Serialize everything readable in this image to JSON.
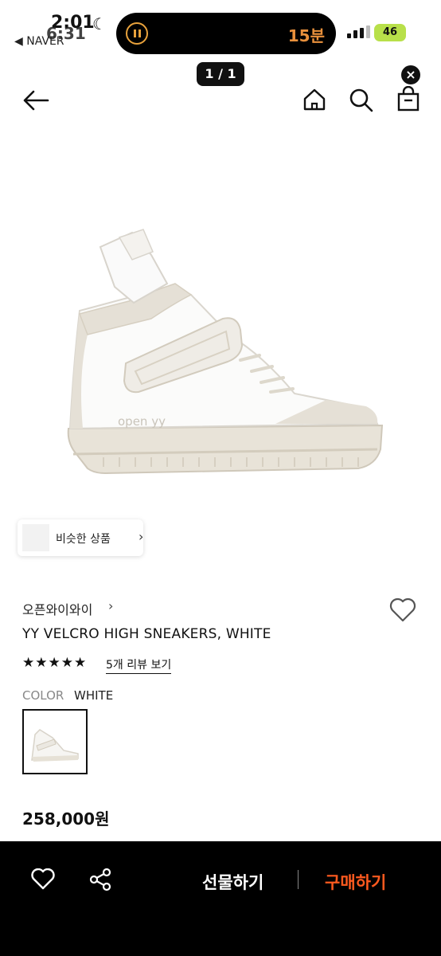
{
  "status_bar": {
    "time": "2:01",
    "time_overlay": "6:31",
    "back_app": "◀ NAVER",
    "timer": "15분",
    "battery": "46"
  },
  "gallery": {
    "counter": "1 / 1"
  },
  "similar_products": {
    "label": "비슷한 상품"
  },
  "product": {
    "brand": "오픈와이와이",
    "title": "YY VELCRO HIGH SNEAKERS, WHITE",
    "stars": "★★★★★",
    "review_link": "5개 리뷰 보기",
    "color_label": "COLOR",
    "color_value": "WHITE",
    "price": "258,000원",
    "logo_text": "open yy"
  },
  "actions": {
    "gift_label": "선물하기",
    "buy_label": "구매하기"
  },
  "colors": {
    "accent": "#ff5a1f",
    "bar_bg": "#000000",
    "sole": "#e9e4da"
  }
}
